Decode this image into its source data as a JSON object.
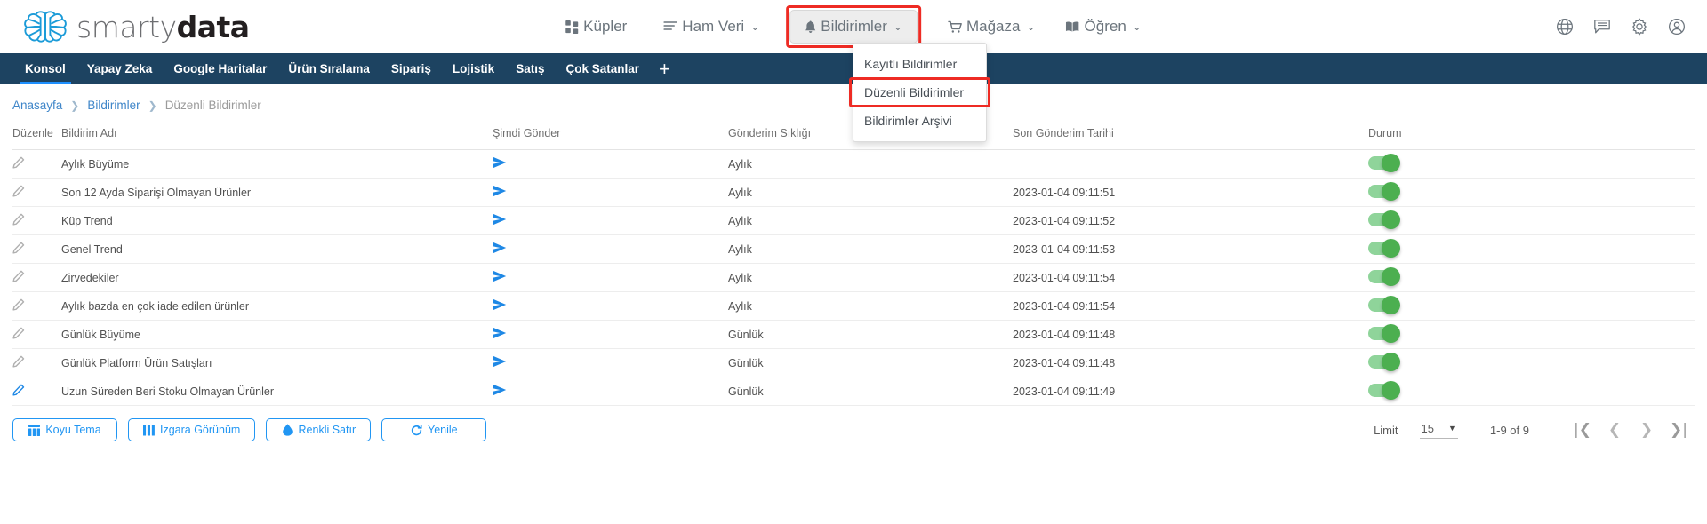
{
  "brand": {
    "name_light": "smarty",
    "name_bold": "data"
  },
  "mainnav": [
    {
      "label": "Küpler",
      "icon": "cubes-icon",
      "caret": "",
      "boxed": false,
      "highlighted": false
    },
    {
      "label": "Ham Veri",
      "icon": "raw-data-icon",
      "caret": "⌄",
      "boxed": false,
      "highlighted": false
    },
    {
      "label": "Bildirimler",
      "icon": "bell-icon",
      "caret": "⌄",
      "boxed": true,
      "highlighted": true
    },
    {
      "label": "Mağaza",
      "icon": "shopping-cart-icon",
      "caret": "⌄",
      "boxed": false,
      "highlighted": false
    },
    {
      "label": "Öğren",
      "icon": "book-icon",
      "caret": "⌄",
      "boxed": false,
      "highlighted": false
    }
  ],
  "header_icons": [
    "globe-icon",
    "chat-icon",
    "gear-icon",
    "user-circle-icon"
  ],
  "dropdown": {
    "items": [
      {
        "label": "Kayıtlı Bildirimler",
        "selected": false
      },
      {
        "label": "Düzenli Bildirimler",
        "selected": true
      },
      {
        "label": "Bildirimler Arşivi",
        "selected": false
      }
    ]
  },
  "subnav": {
    "tabs": [
      {
        "label": "Konsol",
        "active": true
      },
      {
        "label": "Yapay Zeka",
        "active": false
      },
      {
        "label": "Google Haritalar",
        "active": false
      },
      {
        "label": "Ürün Sıralama",
        "active": false
      },
      {
        "label": "Sipariş",
        "active": false
      },
      {
        "label": "Lojistik",
        "active": false
      },
      {
        "label": "Satış",
        "active": false
      },
      {
        "label": "Çok Satanlar",
        "active": false
      }
    ],
    "add_label": "+"
  },
  "breadcrumb": {
    "items": [
      "Anasayfa",
      "Bildirimler",
      "Düzenli Bildirimler"
    ],
    "separator": "❯"
  },
  "table": {
    "columns": [
      "Düzenle",
      "Bildirim Adı",
      "Şimdi Gönder",
      "Gönderim Sıklığı",
      "Son Gönderim Tarihi",
      "Durum"
    ],
    "rows": [
      {
        "name": "Aylık Büyüme",
        "frequency": "Aylık",
        "last_sent": "",
        "status_on": true,
        "edit_active": false
      },
      {
        "name": "Son 12 Ayda Siparişi Olmayan Ürünler",
        "frequency": "Aylık",
        "last_sent": "2023-01-04 09:11:51",
        "status_on": true,
        "edit_active": false
      },
      {
        "name": "Küp Trend",
        "frequency": "Aylık",
        "last_sent": "2023-01-04 09:11:52",
        "status_on": true,
        "edit_active": false
      },
      {
        "name": "Genel Trend",
        "frequency": "Aylık",
        "last_sent": "2023-01-04 09:11:53",
        "status_on": true,
        "edit_active": false
      },
      {
        "name": "Zirvedekiler",
        "frequency": "Aylık",
        "last_sent": "2023-01-04 09:11:54",
        "status_on": true,
        "edit_active": false
      },
      {
        "name": "Aylık bazda en çok iade edilen ürünler",
        "frequency": "Aylık",
        "last_sent": "2023-01-04 09:11:54",
        "status_on": true,
        "edit_active": false
      },
      {
        "name": "Günlük Büyüme",
        "frequency": "Günlük",
        "last_sent": "2023-01-04 09:11:48",
        "status_on": true,
        "edit_active": false
      },
      {
        "name": "Günlük Platform Ürün Satışları",
        "frequency": "Günlük",
        "last_sent": "2023-01-04 09:11:48",
        "status_on": true,
        "edit_active": false
      },
      {
        "name": "Uzun Süreden Beri Stoku Olmayan Ürünler",
        "frequency": "Günlük",
        "last_sent": "2023-01-04 09:11:49",
        "status_on": true,
        "edit_active": true
      }
    ]
  },
  "footer_buttons": [
    {
      "label": "Koyu Tema",
      "icon": "dark-theme-icon"
    },
    {
      "label": "Izgara Görünüm",
      "icon": "grid-view-icon"
    },
    {
      "label": "Renkli Satır",
      "icon": "color-row-icon"
    },
    {
      "label": "Yenile",
      "icon": "refresh-icon"
    }
  ],
  "pagination": {
    "limit_label": "Limit",
    "limit_value": "15",
    "range": "1-9 of 9",
    "first": "|❮",
    "prev": "❮",
    "next": "❯",
    "last": "❯|"
  },
  "colors": {
    "navy": "#1d4361",
    "accent_blue": "#2196f3",
    "link_blue": "#3f86c9",
    "highlight_red": "#ee2b24",
    "toggle_on": "#4caf50"
  }
}
